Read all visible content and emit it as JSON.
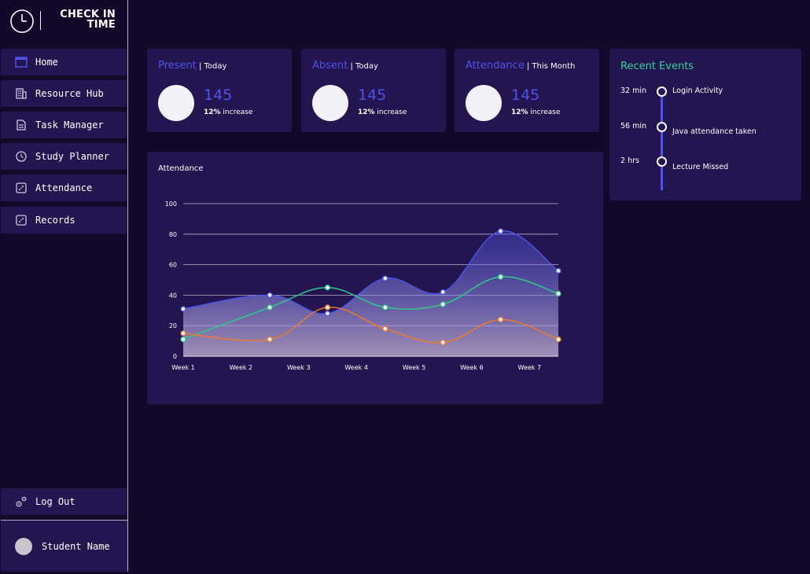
{
  "app": {
    "logo_text_line1": "CHECK IN",
    "logo_text_line2": "TIME"
  },
  "sidebar": {
    "items": [
      {
        "label": "Home",
        "icon": "window-icon"
      },
      {
        "label": "Resource Hub",
        "icon": "building-icon"
      },
      {
        "label": "Task Manager",
        "icon": "document-icon"
      },
      {
        "label": "Study Planner",
        "icon": "clock-icon"
      },
      {
        "label": "Attendance",
        "icon": "dice-icon"
      },
      {
        "label": "Records",
        "icon": "dice-icon"
      }
    ],
    "logout_label": "Log Out",
    "student_name": "Student Name"
  },
  "stats": [
    {
      "label": "Present",
      "period": "Today",
      "value": "145",
      "change": "12%",
      "change_label": "increase"
    },
    {
      "label": "Absent",
      "period": "Today",
      "value": "145",
      "change": "12%",
      "change_label": "increase"
    },
    {
      "label": "Attendance",
      "period": "This Month",
      "value": "145",
      "change": "12%",
      "change_label": "increase"
    }
  ],
  "events": {
    "title": "Recent Events",
    "items": [
      {
        "time": "32 min",
        "text": "Login Activity"
      },
      {
        "time": "56 min",
        "text": "Java attendance taken"
      },
      {
        "time": "2 hrs",
        "text": "Lecture Missed"
      }
    ]
  },
  "colors": {
    "accent": "#4d54e8",
    "events_title": "#2fd39a",
    "card_bg": "#241551",
    "page_bg": "#13072a"
  },
  "chart_data": {
    "type": "line",
    "title": "Attendance",
    "ylim": [
      0,
      100
    ],
    "yticks": [
      0,
      20,
      40,
      60,
      80,
      100
    ],
    "xticks": [
      "Week 1",
      "Week 2",
      "Week 3",
      "Week 4",
      "Week 5",
      "Week 6",
      "Week 7"
    ],
    "grid": true,
    "series": [
      {
        "color": "#4d54e8",
        "area": true,
        "x": [
          1,
          2.5,
          3.5,
          4.5,
          5.5,
          6.5,
          7.5
        ],
        "y": [
          31,
          40,
          28,
          51,
          42,
          82,
          56
        ]
      },
      {
        "color": "#2fc98a",
        "area": false,
        "x": [
          1,
          2.5,
          3.5,
          4.5,
          5.5,
          6.5,
          7.5
        ],
        "y": [
          11,
          32,
          45,
          32,
          34,
          52,
          41
        ]
      },
      {
        "color": "#f07a2c",
        "area": false,
        "x": [
          1,
          2.5,
          3.5,
          4.5,
          5.5,
          6.5,
          7.5
        ],
        "y": [
          15,
          11,
          32,
          18,
          9,
          24,
          11
        ]
      }
    ]
  }
}
